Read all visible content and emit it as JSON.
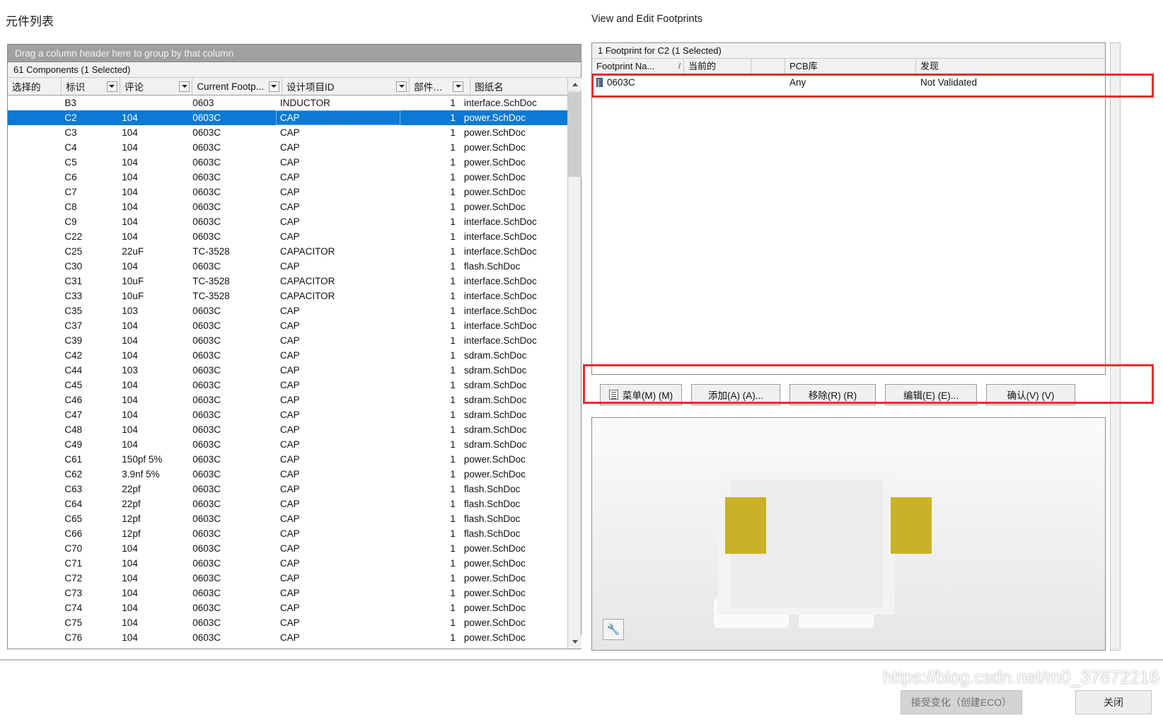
{
  "top_clipped_text": "",
  "left_pane": {
    "title": "元件列表",
    "group_hint": "Drag a column header here to group by that column",
    "count_label": "61 Components (1 Selected)",
    "columns": [
      {
        "key": "selected",
        "label": "选择的",
        "filter": false
      },
      {
        "key": "designator",
        "label": "标识",
        "filter": true
      },
      {
        "key": "comment",
        "label": "评论",
        "filter": true
      },
      {
        "key": "current_footprint",
        "label": "Current Footp...",
        "filter": true
      },
      {
        "key": "design_item_id",
        "label": "设计项目ID",
        "filter": true
      },
      {
        "key": "part_count",
        "label": "部件数目",
        "filter": true
      },
      {
        "key": "sheet_name",
        "label": "图纸名",
        "filter": true
      }
    ],
    "rows": [
      {
        "designator": "B3",
        "comment": "",
        "footprint": "0603",
        "item": "INDUCTOR",
        "parts": "1",
        "sheet": "interface.SchDoc",
        "selected": false
      },
      {
        "designator": "C2",
        "comment": "104",
        "footprint": "0603C",
        "item": "CAP",
        "parts": "1",
        "sheet": "power.SchDoc",
        "selected": true
      },
      {
        "designator": "C3",
        "comment": "104",
        "footprint": "0603C",
        "item": "CAP",
        "parts": "1",
        "sheet": "power.SchDoc",
        "selected": false
      },
      {
        "designator": "C4",
        "comment": "104",
        "footprint": "0603C",
        "item": "CAP",
        "parts": "1",
        "sheet": "power.SchDoc",
        "selected": false
      },
      {
        "designator": "C5",
        "comment": "104",
        "footprint": "0603C",
        "item": "CAP",
        "parts": "1",
        "sheet": "power.SchDoc",
        "selected": false
      },
      {
        "designator": "C6",
        "comment": "104",
        "footprint": "0603C",
        "item": "CAP",
        "parts": "1",
        "sheet": "power.SchDoc",
        "selected": false
      },
      {
        "designator": "C7",
        "comment": "104",
        "footprint": "0603C",
        "item": "CAP",
        "parts": "1",
        "sheet": "power.SchDoc",
        "selected": false
      },
      {
        "designator": "C8",
        "comment": "104",
        "footprint": "0603C",
        "item": "CAP",
        "parts": "1",
        "sheet": "power.SchDoc",
        "selected": false
      },
      {
        "designator": "C9",
        "comment": "104",
        "footprint": "0603C",
        "item": "CAP",
        "parts": "1",
        "sheet": "interface.SchDoc",
        "selected": false
      },
      {
        "designator": "C22",
        "comment": "104",
        "footprint": "0603C",
        "item": "CAP",
        "parts": "1",
        "sheet": "interface.SchDoc",
        "selected": false
      },
      {
        "designator": "C25",
        "comment": "22uF",
        "footprint": "TC-3528",
        "item": "CAPACITOR",
        "parts": "1",
        "sheet": "interface.SchDoc",
        "selected": false
      },
      {
        "designator": "C30",
        "comment": "104",
        "footprint": "0603C",
        "item": "CAP",
        "parts": "1",
        "sheet": "flash.SchDoc",
        "selected": false
      },
      {
        "designator": "C31",
        "comment": "10uF",
        "footprint": "TC-3528",
        "item": "CAPACITOR",
        "parts": "1",
        "sheet": "interface.SchDoc",
        "selected": false
      },
      {
        "designator": "C33",
        "comment": "10uF",
        "footprint": "TC-3528",
        "item": "CAPACITOR",
        "parts": "1",
        "sheet": "interface.SchDoc",
        "selected": false
      },
      {
        "designator": "C35",
        "comment": "103",
        "footprint": "0603C",
        "item": "CAP",
        "parts": "1",
        "sheet": "interface.SchDoc",
        "selected": false
      },
      {
        "designator": "C37",
        "comment": "104",
        "footprint": "0603C",
        "item": "CAP",
        "parts": "1",
        "sheet": "interface.SchDoc",
        "selected": false
      },
      {
        "designator": "C39",
        "comment": "104",
        "footprint": "0603C",
        "item": "CAP",
        "parts": "1",
        "sheet": "interface.SchDoc",
        "selected": false
      },
      {
        "designator": "C42",
        "comment": "104",
        "footprint": "0603C",
        "item": "CAP",
        "parts": "1",
        "sheet": "sdram.SchDoc",
        "selected": false
      },
      {
        "designator": "C44",
        "comment": "103",
        "footprint": "0603C",
        "item": "CAP",
        "parts": "1",
        "sheet": "sdram.SchDoc",
        "selected": false
      },
      {
        "designator": "C45",
        "comment": "104",
        "footprint": "0603C",
        "item": "CAP",
        "parts": "1",
        "sheet": "sdram.SchDoc",
        "selected": false
      },
      {
        "designator": "C46",
        "comment": "104",
        "footprint": "0603C",
        "item": "CAP",
        "parts": "1",
        "sheet": "sdram.SchDoc",
        "selected": false
      },
      {
        "designator": "C47",
        "comment": "104",
        "footprint": "0603C",
        "item": "CAP",
        "parts": "1",
        "sheet": "sdram.SchDoc",
        "selected": false
      },
      {
        "designator": "C48",
        "comment": "104",
        "footprint": "0603C",
        "item": "CAP",
        "parts": "1",
        "sheet": "sdram.SchDoc",
        "selected": false
      },
      {
        "designator": "C49",
        "comment": "104",
        "footprint": "0603C",
        "item": "CAP",
        "parts": "1",
        "sheet": "sdram.SchDoc",
        "selected": false
      },
      {
        "designator": "C61",
        "comment": "150pf 5%",
        "footprint": "0603C",
        "item": "CAP",
        "parts": "1",
        "sheet": "power.SchDoc",
        "selected": false
      },
      {
        "designator": "C62",
        "comment": "3.9nf 5%",
        "footprint": "0603C",
        "item": "CAP",
        "parts": "1",
        "sheet": "power.SchDoc",
        "selected": false
      },
      {
        "designator": "C63",
        "comment": "22pf",
        "footprint": "0603C",
        "item": "CAP",
        "parts": "1",
        "sheet": "flash.SchDoc",
        "selected": false
      },
      {
        "designator": "C64",
        "comment": "22pf",
        "footprint": "0603C",
        "item": "CAP",
        "parts": "1",
        "sheet": "flash.SchDoc",
        "selected": false
      },
      {
        "designator": "C65",
        "comment": "12pf",
        "footprint": "0603C",
        "item": "CAP",
        "parts": "1",
        "sheet": "flash.SchDoc",
        "selected": false
      },
      {
        "designator": "C66",
        "comment": "12pf",
        "footprint": "0603C",
        "item": "CAP",
        "parts": "1",
        "sheet": "flash.SchDoc",
        "selected": false
      },
      {
        "designator": "C70",
        "comment": "104",
        "footprint": "0603C",
        "item": "CAP",
        "parts": "1",
        "sheet": "power.SchDoc",
        "selected": false
      },
      {
        "designator": "C71",
        "comment": "104",
        "footprint": "0603C",
        "item": "CAP",
        "parts": "1",
        "sheet": "power.SchDoc",
        "selected": false
      },
      {
        "designator": "C72",
        "comment": "104",
        "footprint": "0603C",
        "item": "CAP",
        "parts": "1",
        "sheet": "power.SchDoc",
        "selected": false
      },
      {
        "designator": "C73",
        "comment": "104",
        "footprint": "0603C",
        "item": "CAP",
        "parts": "1",
        "sheet": "power.SchDoc",
        "selected": false
      },
      {
        "designator": "C74",
        "comment": "104",
        "footprint": "0603C",
        "item": "CAP",
        "parts": "1",
        "sheet": "power.SchDoc",
        "selected": false
      },
      {
        "designator": "C75",
        "comment": "104",
        "footprint": "0603C",
        "item": "CAP",
        "parts": "1",
        "sheet": "power.SchDoc",
        "selected": false
      },
      {
        "designator": "C76",
        "comment": "104",
        "footprint": "0603C",
        "item": "CAP",
        "parts": "1",
        "sheet": "power.SchDoc",
        "selected": false
      }
    ]
  },
  "right_pane": {
    "title": "View and Edit Footprints",
    "count_label": "1 Footprint for C2 (1 Selected)",
    "columns": [
      {
        "key": "name",
        "label": "Footprint Na...",
        "sort": "/"
      },
      {
        "key": "current",
        "label": "当前的"
      },
      {
        "key": "gap",
        "label": ""
      },
      {
        "key": "pcblib",
        "label": "PCB库"
      },
      {
        "key": "found",
        "label": "发现"
      }
    ],
    "rows": [
      {
        "name": "0603C",
        "current": "",
        "pcblib": "Any",
        "found": "Not Validated",
        "icon": "chip-icon"
      }
    ],
    "buttons": [
      {
        "name": "menu",
        "label": "菜单(M) (M)",
        "icon": "menu-icon"
      },
      {
        "name": "add",
        "label": "添加(A) (A)...",
        "icon": ""
      },
      {
        "name": "remove",
        "label": "移除(R) (R)",
        "icon": ""
      },
      {
        "name": "edit",
        "label": "编辑(E) (E)...",
        "icon": ""
      },
      {
        "name": "confirm",
        "label": "确认(V) (V)",
        "icon": ""
      }
    ],
    "preview_tool_icon": "pin-tool-icon"
  },
  "bottom_bar": {
    "eco_button": "接受变化（创建ECO）",
    "close_button": "关闭",
    "watermark": "https://blog.csdn.net/m0_37872216"
  },
  "colors": {
    "selection_blue": "#0b7ad4",
    "annotation_red": "#e82c2c",
    "pad_gold": "#c9b227",
    "group_bar_gray": "#a0a0a0"
  }
}
